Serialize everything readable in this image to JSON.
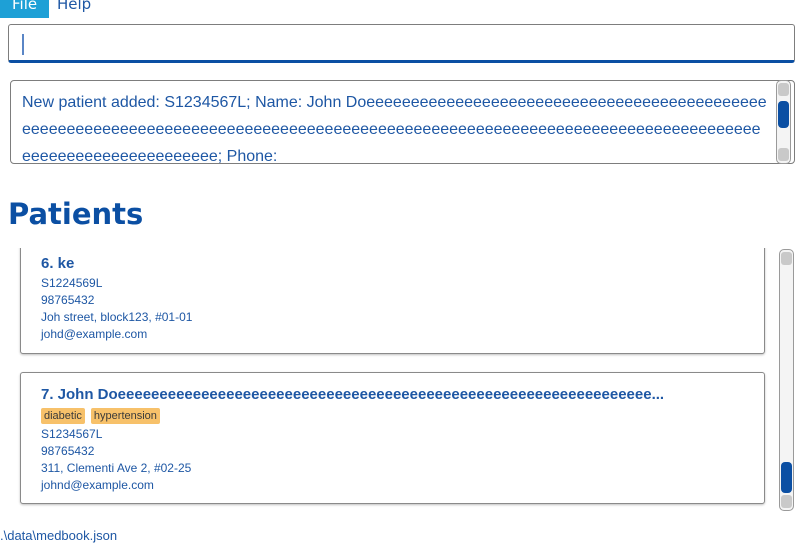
{
  "menubar": {
    "file_label": "File",
    "help_label": "Help"
  },
  "command_box": {
    "value": ""
  },
  "result_display": {
    "text": "New patient added: S1234567L; Name: John Doeeeeeeeeeeeeeeeeeeeeeeeeeeeeeeeeeeeeeeeeeeeeeeeeeeeeeeeeeeeeeeeeeeeeeeeeeeeeeeeeeeeeeeeeeeeeeeeeeeeeeeeeeeeeeeeeeeeeeeeeeeeeeeeeeeeeeeeeeeeeeeeeeeeeee; Phone:"
  },
  "panel_title": "Patients",
  "patients": [
    {
      "index_name": "6.  ke",
      "tags": [],
      "nric": "S1224569L",
      "phone": "98765432",
      "address": "Joh street, block123, #01-01",
      "email": "johd@example.com"
    },
    {
      "index_name": "7.  John Doeeeeeeeeeeeeeeeeeeeeeeeeeeeeeeeeeeeeeeeeeeeeeeeeeeeeeeeeeeeeeeee...",
      "tags": [
        "diabetic",
        "hypertension"
      ],
      "nric": "S1234567L",
      "phone": "98765432",
      "address": "311, Clementi Ave 2, #02-25",
      "email": "johnd@example.com"
    }
  ],
  "statusbar": {
    "path": ".\\data\\medbook.json"
  },
  "colors": {
    "accent": "#0b4fa3",
    "text": "#1e57a4",
    "tag": "#f7c16a",
    "menu_active": "#1ea0d6"
  },
  "result_scroll": {
    "position": 0.1
  },
  "list_scroll": {
    "position": 1.0
  }
}
